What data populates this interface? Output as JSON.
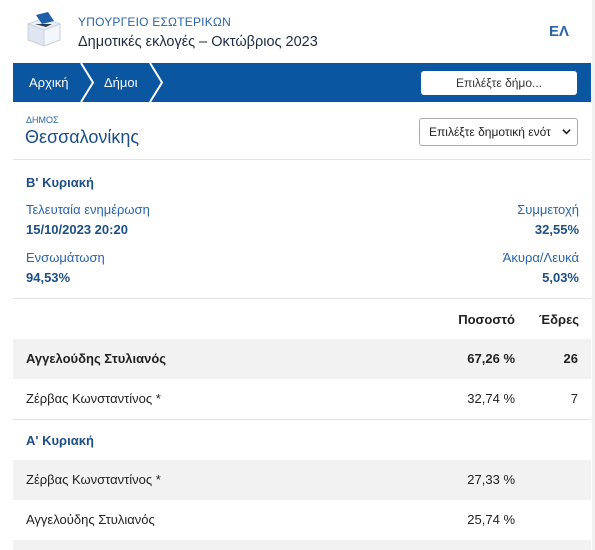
{
  "header": {
    "ministry": "ΥΠΟΥΡΓΕΙΟ ΕΣΩΤΕΡΙΚΩΝ",
    "election": "Δημοτικές εκλογές – Οκτώβριος 2023",
    "lang": "ΕΛ"
  },
  "nav": {
    "crumbs": [
      "Αρχική",
      "Δήμοι"
    ],
    "select_button": "Επιλέξτε δήμο..."
  },
  "municipality": {
    "kicker": "ΔΗΜΟΣ",
    "name": "Θεσσαλονίκης",
    "unit_select": "Επιλέξτε δημοτική ενότ"
  },
  "round_b": {
    "title": "Β' Κυριακή",
    "last_update_label": "Τελευταία ενημέρωση",
    "last_update_value": "15/10/2023 20:20",
    "turnout_label": "Συμμετοχή",
    "turnout_value": "32,55%",
    "integration_label": "Ενσωμάτωση",
    "integration_value": "94,53%",
    "invalid_label": "Άκυρα/Λευκά",
    "invalid_value": "5,03%"
  },
  "table": {
    "col_percent": "Ποσοστό",
    "col_seats": "Έδρες",
    "round_b_rows": [
      {
        "name": "Αγγελούδης Στυλιανός",
        "percent": "67,26 %",
        "seats": "26"
      },
      {
        "name": "Ζέρβας Κωνσταντίνος *",
        "percent": "32,74 %",
        "seats": "7"
      }
    ],
    "round_a_title": "Α' Κυριακή",
    "round_a_rows": [
      {
        "name": "Ζέρβας Κωνσταντίνος *",
        "percent": "27,33 %"
      },
      {
        "name": "Αγγελούδης Στυλιανός",
        "percent": "25,74 %"
      }
    ]
  },
  "colors": {
    "nav_blue": "#0a56a0",
    "accent_blue": "#2a65a8",
    "row_shade": "#f2f2f2"
  },
  "icons": {
    "logo": "ballot-box-icon",
    "chevron": "chevron-down-icon"
  }
}
